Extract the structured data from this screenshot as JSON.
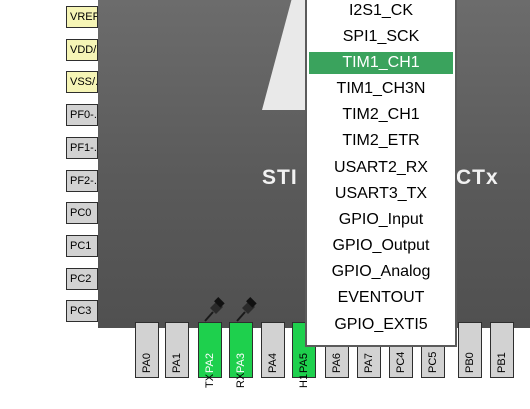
{
  "chip": {
    "name": "STI",
    "name_tail": "CTx"
  },
  "left_pins": [
    {
      "label": "VREF..",
      "kind": "power"
    },
    {
      "label": "VDD/..",
      "kind": "power"
    },
    {
      "label": "VSS/..",
      "kind": "power"
    },
    {
      "label": "PF0-..",
      "kind": "io"
    },
    {
      "label": "PF1-..",
      "kind": "io"
    },
    {
      "label": "PF2-..",
      "kind": "io"
    },
    {
      "label": "PC0",
      "kind": "io"
    },
    {
      "label": "PC1",
      "kind": "io"
    },
    {
      "label": "PC2",
      "kind": "io"
    },
    {
      "label": "PC3",
      "kind": "io"
    }
  ],
  "bottom_pins": [
    {
      "label": "PA0",
      "state": "free"
    },
    {
      "label": "PA1",
      "state": "free"
    },
    {
      "label": "PA2",
      "state": "assigned"
    },
    {
      "label": "PA3",
      "state": "assigned"
    },
    {
      "label": "PA4",
      "state": "free"
    },
    {
      "label": "PA5",
      "state": "assigned"
    },
    {
      "label": "PA6",
      "state": "free"
    },
    {
      "label": "PA7",
      "state": "free"
    },
    {
      "label": "PC4",
      "state": "free"
    },
    {
      "label": "PC5",
      "state": "free"
    },
    {
      "label": "PB0",
      "state": "free"
    },
    {
      "label": "PB1",
      "state": "free"
    }
  ],
  "signals": {
    "pa2": "TX",
    "pa3": "RX",
    "pa5": "H1"
  },
  "menu": {
    "items": [
      "I2S1_CK",
      "SPI1_SCK",
      "TIM1_CH1",
      "TIM1_CH3N",
      "TIM2_CH1",
      "TIM2_ETR",
      "USART2_RX",
      "USART3_TX",
      "GPIO_Input",
      "GPIO_Output",
      "GPIO_Analog",
      "EVENTOUT",
      "GPIO_EXTI5"
    ],
    "selected": "TIM1_CH1"
  },
  "colors": {
    "chip_body": "#5a5a5a",
    "power_pin": "#f6f5b6",
    "io_pin": "#d2d2d2",
    "assigned_pin": "#1ed04d",
    "menu_selected": "#3aa35d"
  }
}
